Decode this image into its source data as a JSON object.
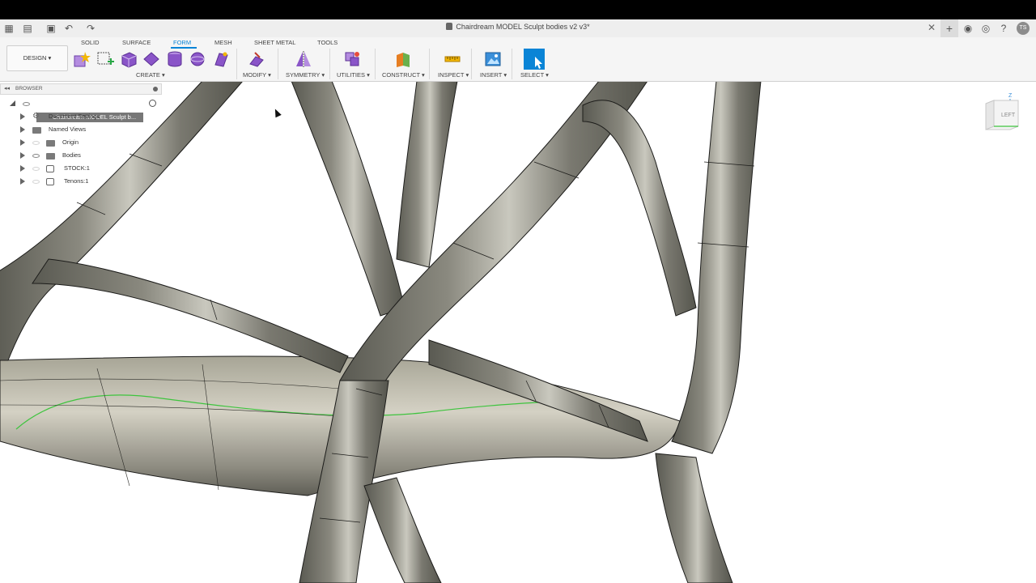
{
  "window": {
    "title": "Chairdream MODEL Sculpt bodies v2 v3*",
    "user_initials": "TS"
  },
  "ribbon": {
    "workspace": "DESIGN",
    "tabs": [
      {
        "label": "SOLID",
        "active": false
      },
      {
        "label": "SURFACE",
        "active": false
      },
      {
        "label": "FORM",
        "active": true
      },
      {
        "label": "MESH",
        "active": false
      },
      {
        "label": "SHEET METAL",
        "active": false
      },
      {
        "label": "TOOLS",
        "active": false
      }
    ],
    "groups": {
      "create": "CREATE",
      "modify": "MODIFY",
      "symmetry": "SYMMETRY",
      "utilities": "UTILITIES",
      "construct": "CONSTRUCT",
      "inspect": "INSPECT",
      "insert": "INSERT",
      "select": "SELECT"
    },
    "accent": "#0a84d6",
    "form_tool_color": "#8a55c8"
  },
  "browser": {
    "header": "BROWSER",
    "root": "Chairdream MODEL Sculpt b...",
    "items": [
      {
        "label": "Document Settings",
        "icon": "gear-icon"
      },
      {
        "label": "Named Views",
        "icon": "folder-icon"
      },
      {
        "label": "Origin",
        "icon": "folder-icon"
      },
      {
        "label": "Bodies",
        "icon": "folder-icon"
      },
      {
        "label": "STOCK:1",
        "icon": "component-icon"
      },
      {
        "label": "Tenons:1",
        "icon": "component-icon"
      }
    ]
  },
  "viewcube": {
    "face_label": "LEFT",
    "axis_label": "Z"
  },
  "model": {
    "surface_color": "#7b7a70",
    "edge_color": "#1c1c1a",
    "highlight_color": "#3ec43e"
  }
}
